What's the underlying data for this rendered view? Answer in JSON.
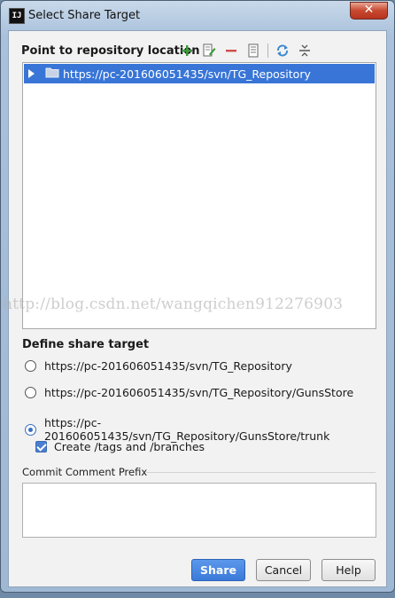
{
  "window": {
    "title": "Select Share Target",
    "icon_text": "IJ",
    "close_symbol": "✕"
  },
  "repository_section": {
    "label": "Point to repository location",
    "toolbar": {
      "add_icon": "plus-icon",
      "edit_icon": "edit-icon",
      "remove_icon": "minus-icon",
      "details_icon": "details-icon",
      "refresh_icon": "refresh-icon",
      "collapse_icon": "collapse-all-icon"
    },
    "tree_items": [
      {
        "url": "https://pc-201606051435/svn/TG_Repository",
        "selected": true
      }
    ]
  },
  "watermark": "http://blog.csdn.net/wangqichen912276903",
  "share_target": {
    "label": "Define share target",
    "options": [
      {
        "label": "https://pc-201606051435/svn/TG_Repository",
        "selected": false
      },
      {
        "label": "https://pc-201606051435/svn/TG_Repository/GunsStore",
        "selected": false
      },
      {
        "label": "https://pc-201606051435/svn/TG_Repository/GunsStore/trunk",
        "selected": true
      }
    ],
    "create_tags_label": "Create /tags and /branches",
    "create_tags_checked": true
  },
  "commit_prefix": {
    "label": "Commit Comment Prefix",
    "value": ""
  },
  "buttons": {
    "share": "Share",
    "cancel": "Cancel",
    "help": "Help"
  },
  "colors": {
    "selection": "#3875d7",
    "primary_button": "#3b7ad9",
    "close_button": "#c7472f"
  }
}
